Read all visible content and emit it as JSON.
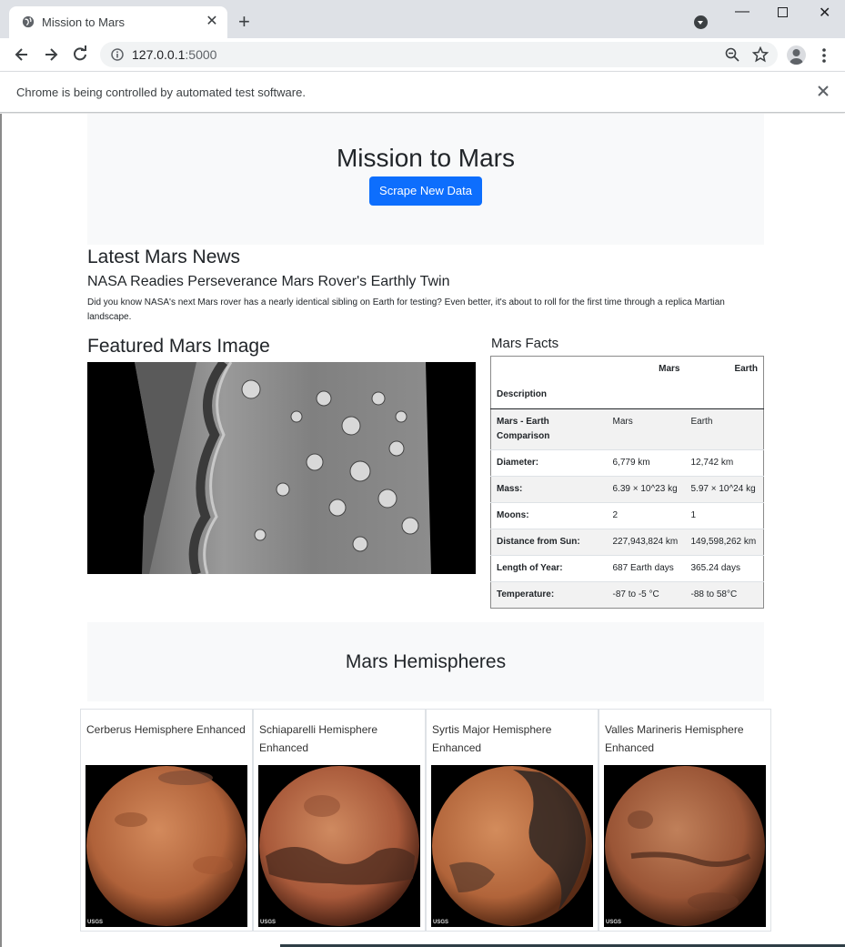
{
  "browser": {
    "tab_title": "Mission to Mars",
    "url_host": "127.0.0.1",
    "url_port": ":5000",
    "infobar_text": "Chrome is being controlled by automated test software."
  },
  "header": {
    "title": "Mission to Mars",
    "scrape_button": "Scrape New Data"
  },
  "news": {
    "section_title": "Latest Mars News",
    "headline": "NASA Readies Perseverance Mars Rover's Earthly Twin",
    "paragraph": "Did you know NASA's next Mars rover has a nearly identical sibling on Earth for testing? Even better, it's about to roll for the first time through a replica Martian landscape."
  },
  "featured": {
    "section_title": "Featured Mars Image"
  },
  "facts": {
    "section_title": "Mars Facts",
    "col_mars": "Mars",
    "col_earth": "Earth",
    "desc_label": "Description",
    "rows": [
      {
        "label": "Mars - Earth Comparison",
        "mars": "Mars",
        "earth": "Earth"
      },
      {
        "label": "Diameter:",
        "mars": "6,779 km",
        "earth": "12,742 km"
      },
      {
        "label": "Mass:",
        "mars": "6.39 × 10^23 kg",
        "earth": "5.97 × 10^24 kg"
      },
      {
        "label": "Moons:",
        "mars": "2",
        "earth": "1"
      },
      {
        "label": "Distance from Sun:",
        "mars": "227,943,824 km",
        "earth": "149,598,262 km"
      },
      {
        "label": "Length of Year:",
        "mars": "687 Earth days",
        "earth": "365.24 days"
      },
      {
        "label": "Temperature:",
        "mars": "-87 to -5 °C",
        "earth": "-88 to 58°C"
      }
    ]
  },
  "hemispheres": {
    "section_title": "Mars Hemispheres",
    "items": [
      {
        "title": "Cerberus Hemisphere Enhanced",
        "logo": "USGS"
      },
      {
        "title": "Schiaparelli Hemisphere Enhanced",
        "logo": "USGS"
      },
      {
        "title": "Syrtis Major Hemisphere Enhanced",
        "logo": "USGS"
      },
      {
        "title": "Valles Marineris Hemisphere Enhanced",
        "logo": "USGS"
      }
    ]
  },
  "colors": {
    "primary_button": "#0d6efd",
    "jumbotron_bg": "#f8f9fa",
    "chrome_tabstrip": "#dee1e6"
  }
}
